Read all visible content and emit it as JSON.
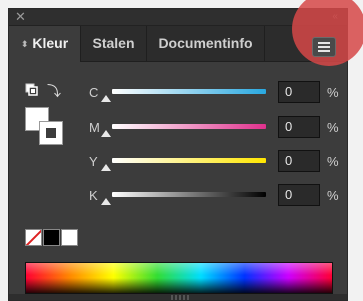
{
  "panel": {
    "close_glyph": "✕",
    "collapse_glyph": "‹‹",
    "tabs": [
      {
        "label": "Kleur",
        "active": true,
        "icon": "sort-arrows-icon"
      },
      {
        "label": "Stalen",
        "active": false
      },
      {
        "label": "Documentinfo",
        "active": false
      }
    ],
    "menu_icon": "hamburger-menu-icon",
    "highlight_color": "#d64848"
  },
  "cmyk": [
    {
      "label": "C",
      "value": "0",
      "unit": "%",
      "gradient_to": "#29a8e0"
    },
    {
      "label": "M",
      "value": "0",
      "unit": "%",
      "gradient_to": "#e0318d"
    },
    {
      "label": "Y",
      "value": "0",
      "unit": "%",
      "gradient_to": "#ffe600"
    },
    {
      "label": "K",
      "value": "0",
      "unit": "%",
      "gradient_to": "#000000"
    }
  ],
  "swatches": {
    "fill": "#ffffff",
    "stroke": "#ffffff",
    "quick": [
      "none",
      "black",
      "white"
    ]
  }
}
